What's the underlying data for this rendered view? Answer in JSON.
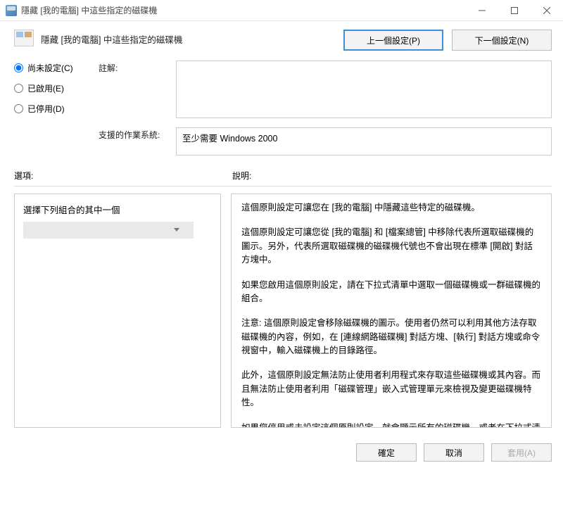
{
  "window": {
    "title": "隱藏 [我的電腦] 中這些指定的磁碟機"
  },
  "header": {
    "title": "隱藏 [我的電腦] 中這些指定的磁碟機",
    "prevBtn": "上一個設定(P)",
    "nextBtn": "下一個設定(N)"
  },
  "radios": {
    "notConfigured": "尚未設定(C)",
    "enabled": "已啟用(E)",
    "disabled": "已停用(D)"
  },
  "fields": {
    "commentLabel": "註解:",
    "commentValue": "",
    "supportedOsLabel": "支援的作業系統:",
    "supportedOsValue": "至少需要 Windows 2000"
  },
  "panels": {
    "optionsLabel": "選項:",
    "helpLabel": "說明:",
    "comboLabel": "選擇下列組合的其中一個",
    "comboValue": ""
  },
  "help": {
    "p1": "這個原則設定可讓您在 [我的電腦] 中隱藏這些特定的磁碟機。",
    "p2": "這個原則設定可讓您從 [我的電腦] 和 [檔案總管] 中移除代表所選取磁碟機的圖示。另外，代表所選取磁碟機的磁碟機代號也不會出現在標準 [開啟] 對話方塊中。",
    "p3": "如果您啟用這個原則設定，請在下拉式清單中選取一個磁碟機或一群磁碟機的組合。",
    "p4": "注意: 這個原則設定會移除磁碟機的圖示。使用者仍然可以利用其他方法存取磁碟機的內容，例如，在 [連線網路磁碟機] 對話方塊、[執行] 對話方塊或命令視窗中，輸入磁碟機上的目錄路徑。",
    "p5": "此外，這個原則設定無法防止使用者利用程式來存取這些磁碟機或其內容。而且無法防止使用者利用「磁碟管理」嵌入式管理單元來檢視及變更磁碟機特性。",
    "p6": "如果您停用或未設定這個原則設定，就會顯示所有的磁碟機，或者在下拉式清單中選取 [不限制磁碟] 選項。"
  },
  "footer": {
    "ok": "確定",
    "cancel": "取消",
    "apply": "套用(A)"
  }
}
